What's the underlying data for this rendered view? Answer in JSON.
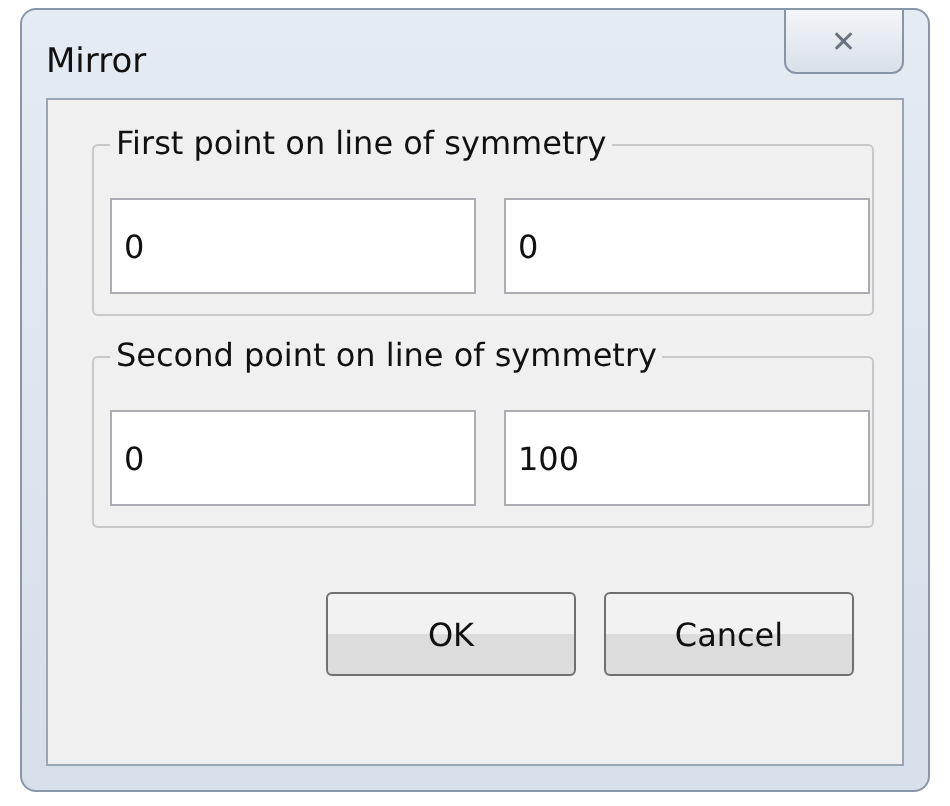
{
  "window": {
    "title": "Mirror",
    "close": "✕"
  },
  "groups": [
    {
      "label": "First point on line of symmetry",
      "fields": [
        {
          "value": "0"
        },
        {
          "value": "0"
        }
      ]
    },
    {
      "label": "Second point on line of symmetry",
      "fields": [
        {
          "value": "0"
        },
        {
          "value": "100"
        }
      ]
    }
  ],
  "buttons": [
    "OK",
    "Cancel"
  ]
}
